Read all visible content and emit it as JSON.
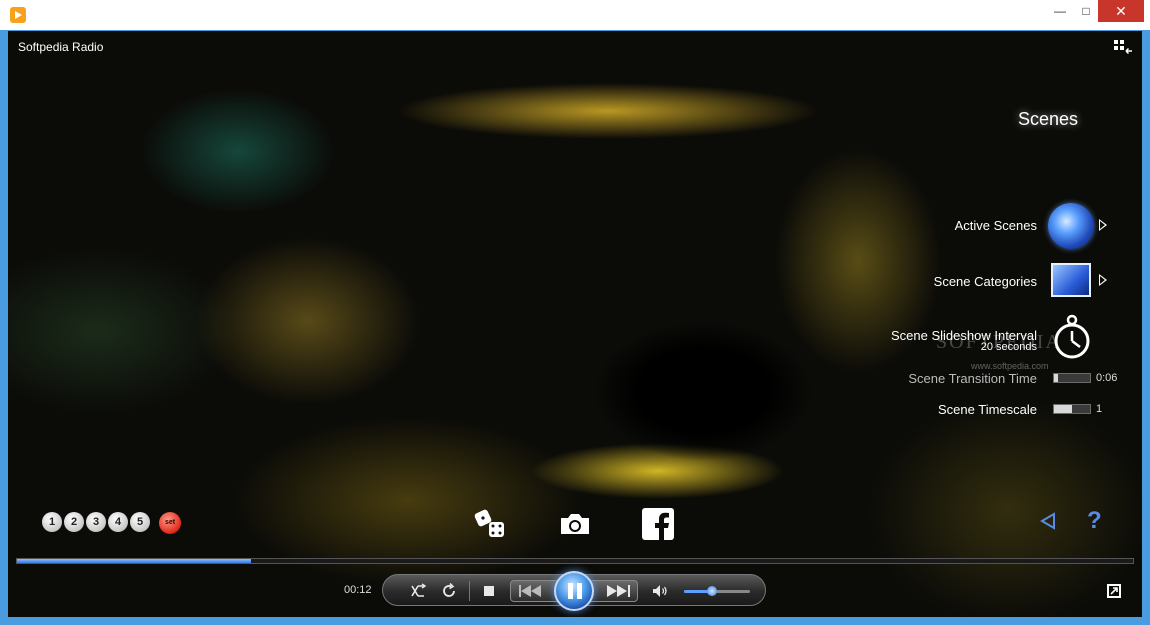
{
  "window": {
    "minimize_glyph": "—",
    "maximize_glyph": "□",
    "close_glyph": "✕"
  },
  "app": {
    "title": "Softpedia Radio"
  },
  "scenes_panel": {
    "heading": "Scenes",
    "active_scenes_label": "Active Scenes",
    "scene_categories_label": "Scene Categories",
    "slideshow_interval_label": "Scene Slideshow Interval",
    "slideshow_interval_value": "20 seconds",
    "transition_time_label": "Scene Transition Time",
    "transition_time_value": "0:06",
    "transition_time_fraction": 0.12,
    "timescale_label": "Scene Timescale",
    "timescale_value": "1",
    "timescale_fraction": 0.5
  },
  "watermark": {
    "logo_text": "SOFTPEDIA",
    "url": "www.softpedia.com"
  },
  "presets": {
    "items": [
      "1",
      "2",
      "3",
      "4",
      "5"
    ],
    "set_label": "set"
  },
  "playback": {
    "elapsed": "00:12",
    "progress_fraction": 0.21,
    "volume_fraction": 0.42
  },
  "icons": {
    "app": "app-icon",
    "layout": "layout-toggle-icon",
    "random": "dice-icon",
    "screenshot": "camera-icon",
    "share": "facebook-icon",
    "back": "back-triangle-icon",
    "help": "help-icon",
    "fullscreen": "fullscreen-icon"
  },
  "colors": {
    "accent": "#3a7ae0",
    "close_red": "#c7352b",
    "window_border": "#4a9ce0"
  }
}
